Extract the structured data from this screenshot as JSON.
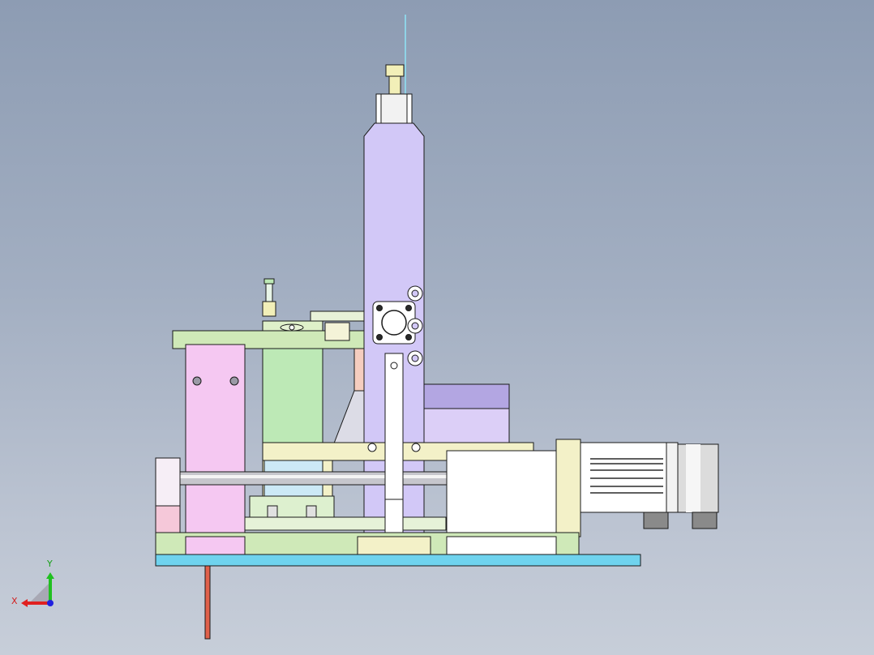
{
  "viewport": {
    "background_top": "#8d9cb3",
    "background_bottom": "#c7ced9"
  },
  "triad": {
    "x_label": "X",
    "y_label": "Y",
    "x_color": "#e02020",
    "y_color": "#20c020",
    "z_color": "#2020e0",
    "x_label_color": "#d22020",
    "y_label_color": "#18a018"
  },
  "palette": {
    "outline": "#1a1a1a",
    "base_plate": "#6fd3ee",
    "rod": "#e0604a",
    "column": "#d2c8f7",
    "pink_block": "#f5c8f2",
    "green_part": "#bde9b6",
    "yellow_part": "#f3f1c8",
    "motor_white": "#ffffff",
    "motor_grey": "#d0d0d0",
    "purple_block": "#b3a6e2",
    "light_blue": "#cce9f6"
  }
}
